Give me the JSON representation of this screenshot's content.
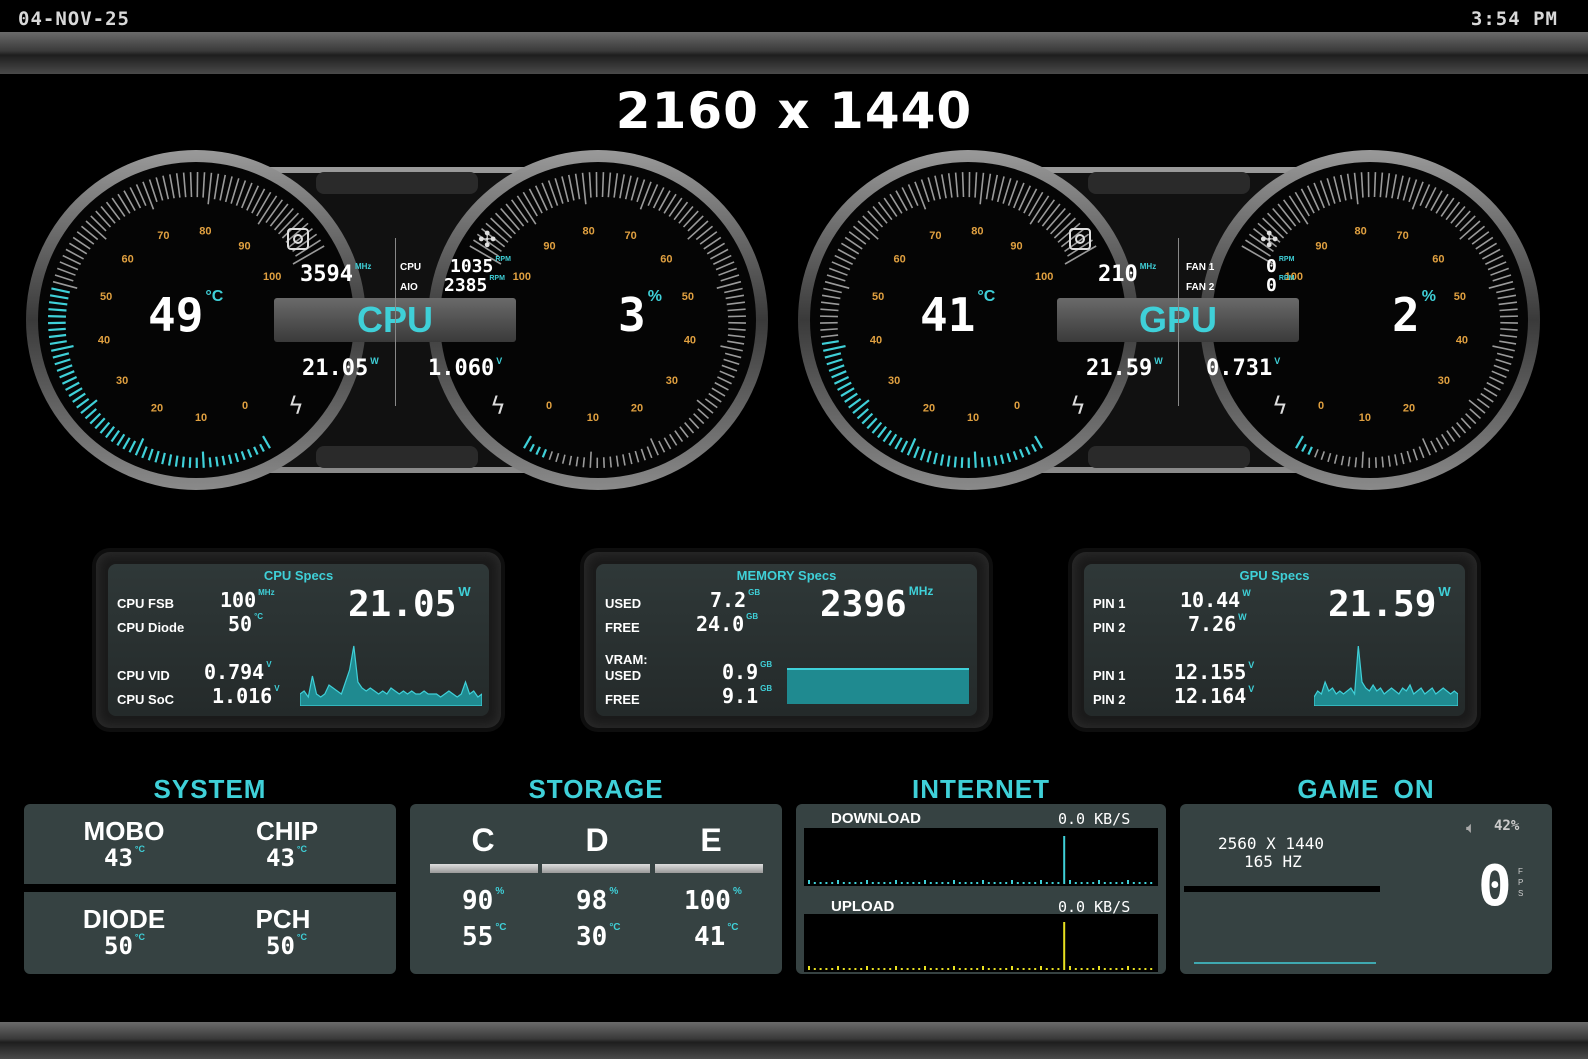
{
  "top": {
    "date": "04-NOV-25",
    "time": "3:54 PM"
  },
  "resolution": "2160 x 1440",
  "cpu": {
    "label": "CPU",
    "temp": "49",
    "temp_unit": "°C",
    "load": "3",
    "load_unit": "%",
    "clock": "3594",
    "clock_unit": "MHz",
    "fan_label_1": "CPU",
    "fan_label_2": "AIO",
    "fan_1": "1035",
    "fan_2": "2385",
    "fan_unit": "RPM",
    "power": "21.05",
    "power_unit": "W",
    "voltage": "1.060",
    "voltage_unit": "V",
    "left_ticks": [
      "0",
      "10",
      "20",
      "30",
      "40",
      "50",
      "60",
      "70",
      "80",
      "90",
      "100"
    ],
    "right_ticks": [
      "0",
      "10",
      "20",
      "30",
      "40",
      "50",
      "60",
      "70",
      "80",
      "90",
      "100"
    ],
    "temp_fraction": 0.49,
    "load_fraction": 0.03
  },
  "gpu": {
    "label": "GPU",
    "temp": "41",
    "temp_unit": "°C",
    "load": "2",
    "load_unit": "%",
    "clock": "210",
    "clock_unit": "MHz",
    "fan_label_1": "FAN 1",
    "fan_label_2": "FAN 2",
    "fan_1": "0",
    "fan_2": "0",
    "fan_unit": "RPM",
    "power": "21.59",
    "power_unit": "W",
    "voltage": "0.731",
    "voltage_unit": "V",
    "left_ticks": [
      "0",
      "10",
      "20",
      "30",
      "40",
      "50",
      "60",
      "70",
      "80",
      "90",
      "100"
    ],
    "right_ticks": [
      "0",
      "10",
      "20",
      "30",
      "40",
      "50",
      "60",
      "70",
      "80",
      "90",
      "100"
    ],
    "temp_fraction": 0.41,
    "load_fraction": 0.02
  },
  "cpu_specs": {
    "title": "CPU Specs",
    "fsb_label": "CPU FSB",
    "fsb": "100",
    "fsb_unit": "MHz",
    "diode_label": "CPU Diode",
    "diode": "50",
    "diode_unit": "°C",
    "vid_label": "CPU VID",
    "vid": "0.794",
    "vid_unit": "V",
    "soc_label": "CPU SoC",
    "soc": "1.016",
    "soc_unit": "V",
    "power": "21.05",
    "power_unit": "W",
    "graph": [
      4,
      5,
      3,
      10,
      4,
      3,
      4,
      7,
      6,
      5,
      4,
      8,
      12,
      20,
      8,
      6,
      5,
      6,
      5,
      4,
      5,
      4,
      6,
      5,
      4,
      5,
      4,
      5,
      4,
      4,
      5,
      4,
      4,
      4,
      3,
      4,
      5,
      4,
      3,
      4,
      8,
      4,
      5,
      3,
      4
    ]
  },
  "memory_specs": {
    "title": "MEMORY Specs",
    "used_label": "USED",
    "used": "7.2",
    "used_unit": "GB",
    "free_label": "FREE",
    "free": "24.0",
    "free_unit": "GB",
    "clock": "2396",
    "clock_unit": "MHz",
    "vram_label": "VRAM:",
    "vram_used_label": "USED",
    "vram_used": "0.9",
    "vram_used_unit": "GB",
    "vram_free_label": "FREE",
    "vram_free": "9.1",
    "vram_free_unit": "GB",
    "vram_fraction": 0.09
  },
  "gpu_specs": {
    "title": "GPU Specs",
    "pin1_label": "PIN 1",
    "pin1_w": "10.44",
    "pin2_label": "PIN 2",
    "pin2_w": "7.26",
    "w_unit": "W",
    "pin1v_label": "PIN 1",
    "pin1_v": "12.155",
    "pin2v_label": "PIN 2",
    "pin2_v": "12.164",
    "v_unit": "V",
    "power": "21.59",
    "power_unit": "W",
    "graph": [
      3,
      5,
      4,
      8,
      5,
      6,
      4,
      5,
      4,
      5,
      6,
      4,
      20,
      8,
      6,
      5,
      7,
      5,
      6,
      4,
      5,
      6,
      5,
      4,
      6,
      5,
      7,
      4,
      5,
      6,
      4,
      5,
      6,
      4,
      5,
      6,
      5,
      4,
      5,
      4
    ]
  },
  "system": {
    "title": "SYSTEM",
    "items": [
      {
        "label": "MOBO",
        "value": "43",
        "unit": "°C"
      },
      {
        "label": "CHIP",
        "value": "43",
        "unit": "°C"
      },
      {
        "label": "DIODE",
        "value": "50",
        "unit": "°C"
      },
      {
        "label": "PCH",
        "value": "50",
        "unit": "°C"
      }
    ]
  },
  "storage": {
    "title": "STORAGE",
    "drives": [
      {
        "label": "C",
        "usage": "90",
        "usage_unit": "%",
        "temp": "55",
        "temp_unit": "°C"
      },
      {
        "label": "D",
        "usage": "98",
        "usage_unit": "%",
        "temp": "30",
        "temp_unit": "°C"
      },
      {
        "label": "E",
        "usage": "100",
        "usage_unit": "%",
        "temp": "41",
        "temp_unit": "°C"
      }
    ]
  },
  "internet": {
    "title": "INTERNET",
    "download_label": "DOWNLOAD",
    "download": "0.0 KB/S",
    "upload_label": "UPLOAD",
    "upload": "0.0 KB/S",
    "download_color": "#3fd0d8",
    "upload_color": "#e8e020"
  },
  "game": {
    "title": "GAME ON",
    "volume": "42%",
    "resolution": "2560 X 1440",
    "refresh": "165 HZ",
    "fps": "0",
    "fps_label": "FPS"
  },
  "colors": {
    "accent": "#3fd0d8",
    "panel": "#364242"
  }
}
